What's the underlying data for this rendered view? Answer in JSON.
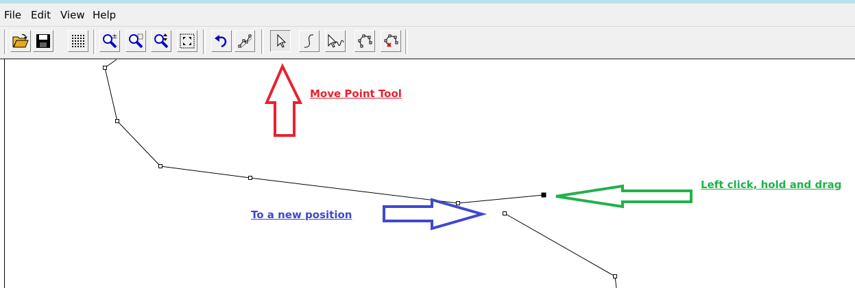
{
  "menu": {
    "items": [
      "File",
      "Edit",
      "View",
      "Help"
    ]
  },
  "toolbar": {
    "buttons": [
      {
        "name": "open-file-button",
        "icon": "folder-open-icon"
      },
      {
        "name": "save-button",
        "icon": "floppy-disk-icon"
      },
      {
        "name": "grid-button",
        "icon": "grid-dots-icon"
      },
      {
        "name": "zoom-in-out-button",
        "icon": "zoom-plus-minus-icon"
      },
      {
        "name": "zoom-window-button",
        "icon": "zoom-window-icon"
      },
      {
        "name": "zoom-pan-button",
        "icon": "zoom-pan-icon"
      },
      {
        "name": "zoom-extents-button",
        "icon": "zoom-extents-icon"
      },
      {
        "name": "undo-button",
        "icon": "undo-arrow-icon"
      },
      {
        "name": "polyline-tool-button",
        "icon": "polyline-icon"
      },
      {
        "name": "move-point-tool-button",
        "icon": "pointer-arrow-icon"
      },
      {
        "name": "curve-tool-button",
        "icon": "s-curve-icon"
      },
      {
        "name": "freehand-select-button",
        "icon": "pointer-wave-icon"
      },
      {
        "name": "add-vertex-button",
        "icon": "polygon-vertices-icon"
      },
      {
        "name": "delete-vertex-button",
        "icon": "polygon-delete-vertex-icon"
      }
    ]
  },
  "annotations": {
    "move_point_tool": "Move Point Tool",
    "left_click_drag": "Left click, hold and drag",
    "new_position": "To a new position"
  },
  "colors": {
    "red": "#e8222e",
    "green": "#21b14b",
    "blue": "#3f48cc",
    "menubar": "#f0f0f0",
    "accent_line": "#b7e2ea"
  }
}
